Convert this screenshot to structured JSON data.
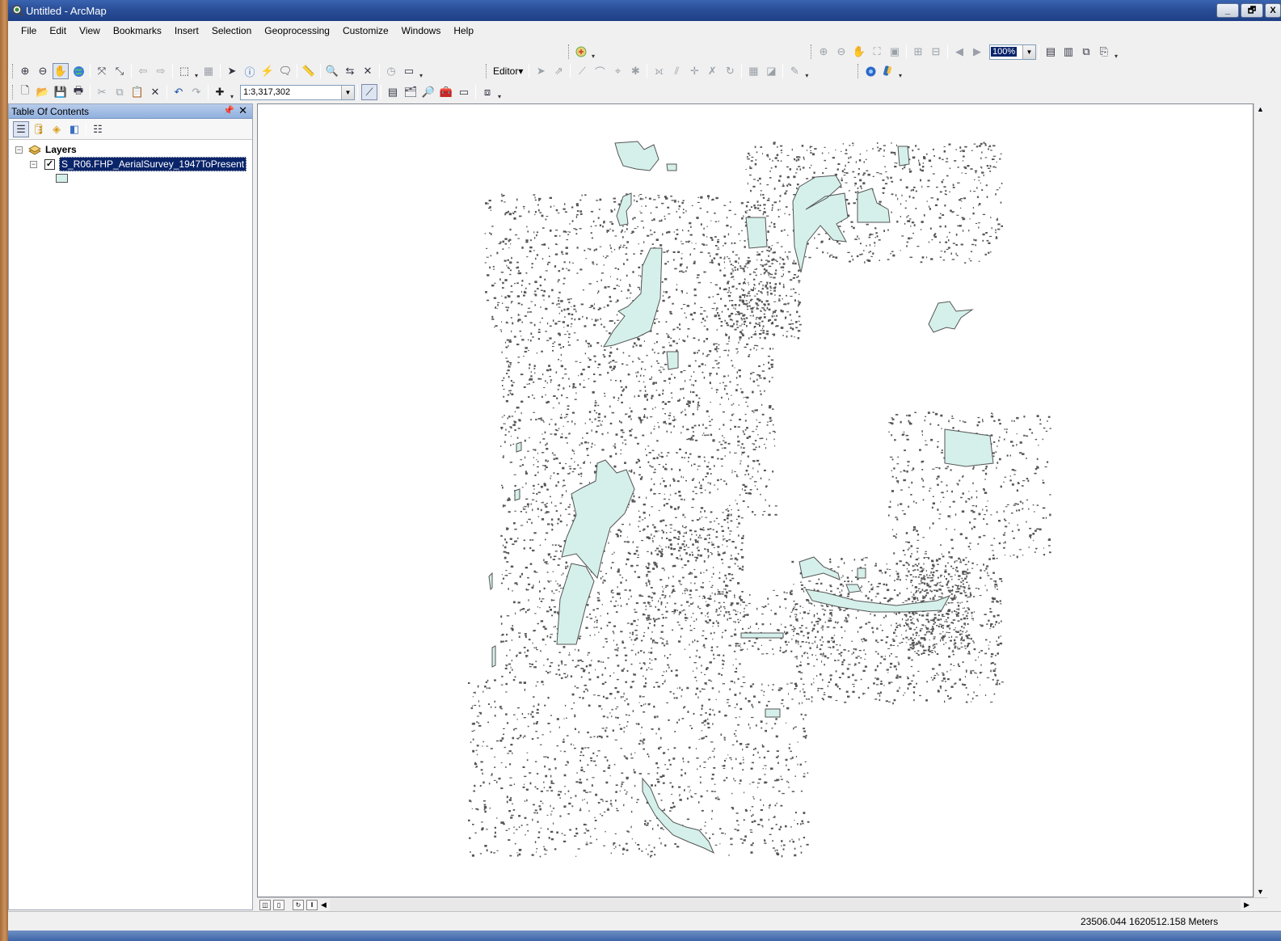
{
  "window": {
    "title": "Untitled - ArcMap",
    "minimize": "_",
    "restore": "🗗",
    "close": "X"
  },
  "menu": [
    "File",
    "Edit",
    "View",
    "Bookmarks",
    "Insert",
    "Selection",
    "Geoprocessing",
    "Customize",
    "Windows",
    "Help"
  ],
  "toolbar": {
    "scale_value": "1:3,317,302",
    "zoom_percent": "100%",
    "editor_label": "Editor▾"
  },
  "toc": {
    "title": "Table Of Contents",
    "group_label": "Layers",
    "layer_name": "S_R06.FHP_AerialSurvey_1947ToPresent"
  },
  "status": {
    "coordinates": "23506.044  1620512.158 Meters"
  },
  "colors": {
    "polygon_fill": "#d5f0ea",
    "feature_stroke": "#555555",
    "selection": "#0a246a"
  }
}
